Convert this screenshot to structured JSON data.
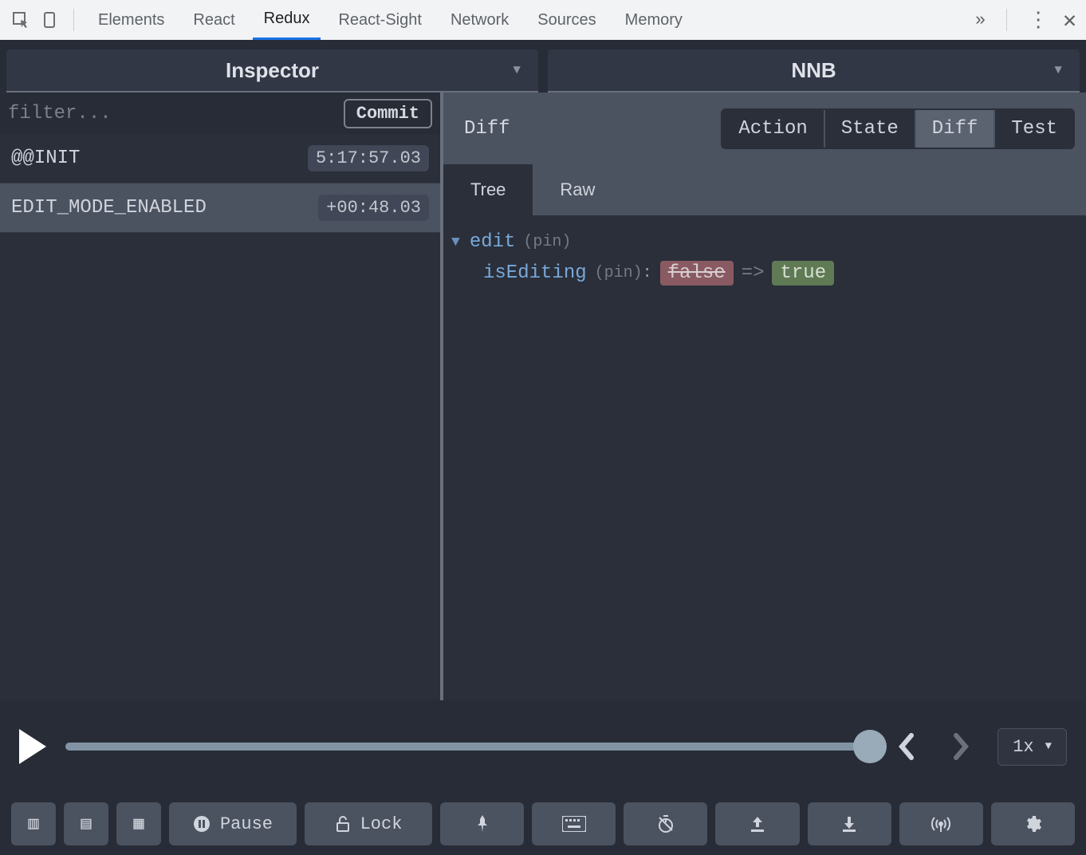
{
  "chromeTabs": [
    "Elements",
    "React",
    "Redux",
    "React-Sight",
    "Network",
    "Sources",
    "Memory"
  ],
  "chromeActiveTab": "Redux",
  "selectors": {
    "left": "Inspector",
    "right": "NNB"
  },
  "filter": {
    "placeholder": "filter...",
    "commit": "Commit"
  },
  "actions": [
    {
      "name": "@@INIT",
      "time": "5:17:57.03",
      "selected": false
    },
    {
      "name": "EDIT_MODE_ENABLED",
      "time": "+00:48.03",
      "selected": true
    }
  ],
  "rightHeader": {
    "title": "Diff",
    "buttons": [
      "Action",
      "State",
      "Diff",
      "Test"
    ],
    "active": "Diff"
  },
  "subtabs": {
    "items": [
      "Tree",
      "Raw"
    ],
    "active": "Tree"
  },
  "diff": {
    "root": "edit",
    "pin": "(pin)",
    "child": {
      "key": "isEditing",
      "pin": "(pin)",
      "old": "false",
      "arrow": "=>",
      "new": "true"
    }
  },
  "slider": {
    "speed": "1x"
  },
  "bottom": {
    "pause": "Pause",
    "lock": "Lock"
  }
}
